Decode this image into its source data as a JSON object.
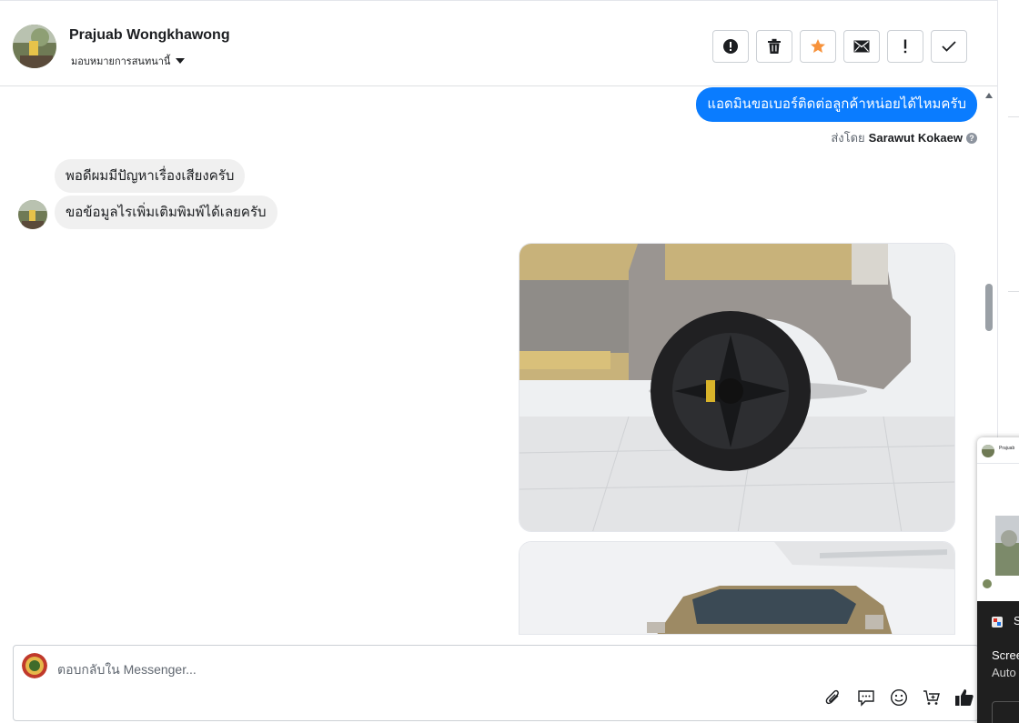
{
  "header": {
    "contact_name": "Prajuab Wongkhawong",
    "assign_label": "มอบหมายการสนทนานี้",
    "actions": [
      {
        "icon": "alert-circle-icon",
        "name": "mark-spam-button"
      },
      {
        "icon": "trash-icon",
        "name": "delete-button"
      },
      {
        "icon": "star-icon",
        "name": "star-button"
      },
      {
        "icon": "envelope-icon",
        "name": "mark-unread-button"
      },
      {
        "icon": "exclamation-icon",
        "name": "follow-up-button"
      },
      {
        "icon": "check-icon",
        "name": "mark-done-button"
      }
    ]
  },
  "messages": {
    "outgoing_text": "แอดมินขอเบอร์ติดต่อลูกค้าหน่อยได้ไหมครับ",
    "sent_by_prefix": "ส่งโดย",
    "sent_by_name": "Sarawut Kokaew",
    "incoming_1": "พอดีผมมีปัญหาเรื่องเสียงครับ",
    "incoming_2": "ขอข้อมูลไรเพิ่มเติมพิมพ์ได้เลยครับ"
  },
  "composer": {
    "placeholder": "ตอบกลับใน Messenger...",
    "tools": [
      "paperclip-icon",
      "chat-bubble-icon",
      "emoji-icon",
      "cart-add-icon",
      "thumbs-up-icon"
    ]
  },
  "overlay": {
    "name": "Prajuab",
    "s_label": "S",
    "text_1": "Scree",
    "text_2": "Auto"
  },
  "colors": {
    "accent": "#0a7cff",
    "star": "#f7923b",
    "bubble_in": "#f0f0f0"
  }
}
